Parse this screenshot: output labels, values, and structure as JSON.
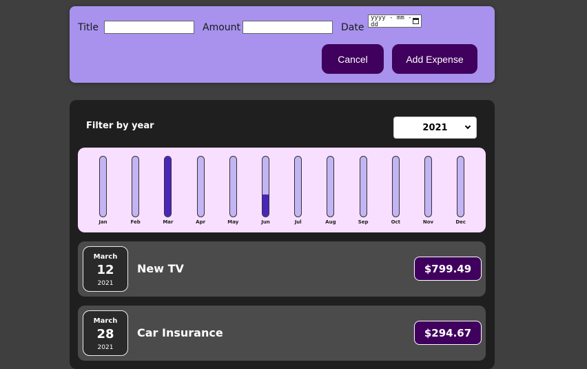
{
  "form": {
    "title_label": "Title",
    "title_value": "",
    "amount_label": "Amount",
    "amount_value": "",
    "date_label": "Date",
    "date_placeholder": "yyyy - mm - dd",
    "cancel_label": "Cancel",
    "add_label": "Add Expense"
  },
  "filter": {
    "label": "Filter by year",
    "selected_year": "2021"
  },
  "chart_data": {
    "type": "bar",
    "categories": [
      "Jan",
      "Feb",
      "Mar",
      "Apr",
      "May",
      "Jun",
      "Jul",
      "Aug",
      "Sep",
      "Oct",
      "Nov",
      "Dec"
    ],
    "values": [
      0,
      0,
      799.49,
      0,
      0,
      294.67,
      0,
      0,
      0,
      0,
      0,
      0
    ],
    "max": 799.49
  },
  "expenses": [
    {
      "month": "March",
      "day": "12",
      "year": "2021",
      "title": "New TV",
      "amount": "$799.49"
    },
    {
      "month": "March",
      "day": "28",
      "year": "2021",
      "title": "Car Insurance",
      "amount": "$294.67"
    }
  ],
  "colors": {
    "form_bg": "#a892ee",
    "button_bg": "#40005d",
    "chart_bg": "#f8dfff",
    "bar_empty": "#c3b4f3",
    "bar_fill": "#4826b9"
  }
}
